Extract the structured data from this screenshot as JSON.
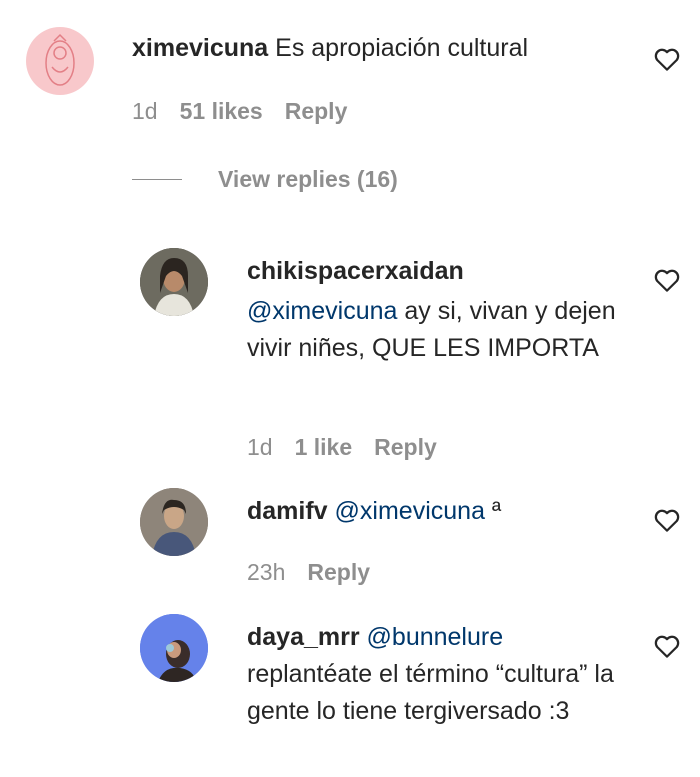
{
  "comments": [
    {
      "username": "ximevicuna",
      "text": "Es apropiación cultural",
      "mention": "",
      "time": "1d",
      "likes": "51 likes",
      "reply": "Reply",
      "view_replies": "View replies (16)"
    },
    {
      "username": "chikispacerxaidan",
      "mention": "@ximevicuna",
      "text": " ay si, vivan y dejen vivir niñes, QUE LES IMPORTA",
      "time": "1d",
      "likes": "1 like",
      "reply": "Reply"
    },
    {
      "username": "damifv",
      "mention": "@ximevicuna",
      "text": " ª",
      "time": "23h",
      "reply": "Reply"
    },
    {
      "username": "daya_mrr",
      "mention": "@bunnelure",
      "text": " replantéate el término “cultura” la gente lo tiene tergiversado :3"
    }
  ],
  "colors": {
    "text": "#262626",
    "muted": "#8e8e8e",
    "mention": "#00376b",
    "avatar1": "#f7c6c9"
  }
}
